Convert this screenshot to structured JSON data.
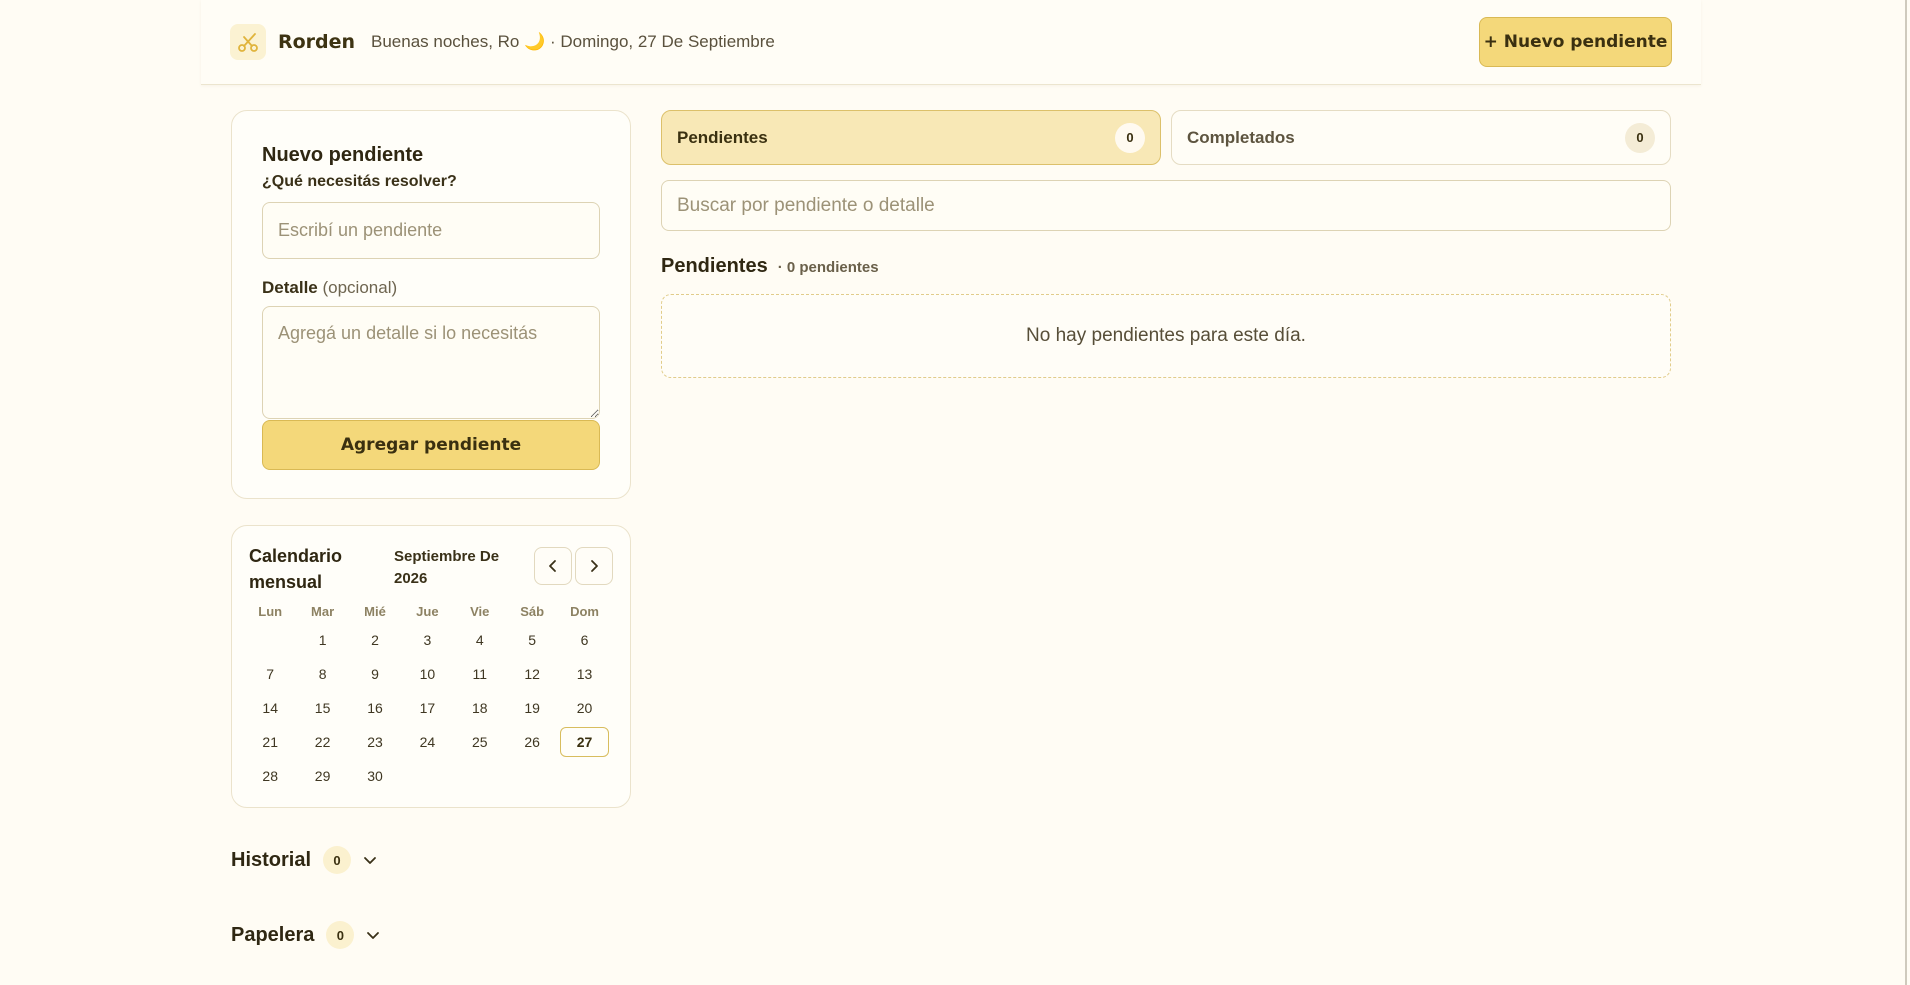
{
  "header": {
    "brand": "Rorden",
    "greeting": "Buenas noches, Ro 🌙 · Domingo, 27 De Septiembre",
    "new_button": "+ Nuevo pendiente",
    "logo_icon": "scissors-icon"
  },
  "form": {
    "title": "Nuevo pendiente",
    "question": "¿Qué necesitás resolver?",
    "task_placeholder": "Escribí un pendiente",
    "detail_label": "Detalle",
    "detail_optional": "(opcional)",
    "detail_placeholder": "Agregá un detalle si lo necesitás",
    "submit": "Agregar pendiente"
  },
  "calendar": {
    "title": "Calendario mensual",
    "month": "Septiembre De 2026",
    "weekdays": [
      "Lun",
      "Mar",
      "Mié",
      "Jue",
      "Vie",
      "Sáb",
      "Dom"
    ],
    "leading_blanks": 1,
    "days_in_month": 30,
    "selected_day": 27,
    "prev_icon": "chevron-left-icon",
    "next_icon": "chevron-right-icon"
  },
  "sections": {
    "history": {
      "label": "Historial",
      "count": "0"
    },
    "trash": {
      "label": "Papelera",
      "count": "0"
    }
  },
  "tabs": {
    "pending": {
      "label": "Pendientes",
      "count": "0"
    },
    "completed": {
      "label": "Completados",
      "count": "0"
    }
  },
  "search": {
    "placeholder": "Buscar por pendiente o detalle"
  },
  "list": {
    "title": "Pendientes",
    "count_text": "· 0 pendientes",
    "empty": "No hay pendientes para este día."
  },
  "colors": {
    "accent": "#f4d87a",
    "accent_border": "#d9b954",
    "background": "#fffcf4",
    "tab_active": "#f8e8b6"
  }
}
